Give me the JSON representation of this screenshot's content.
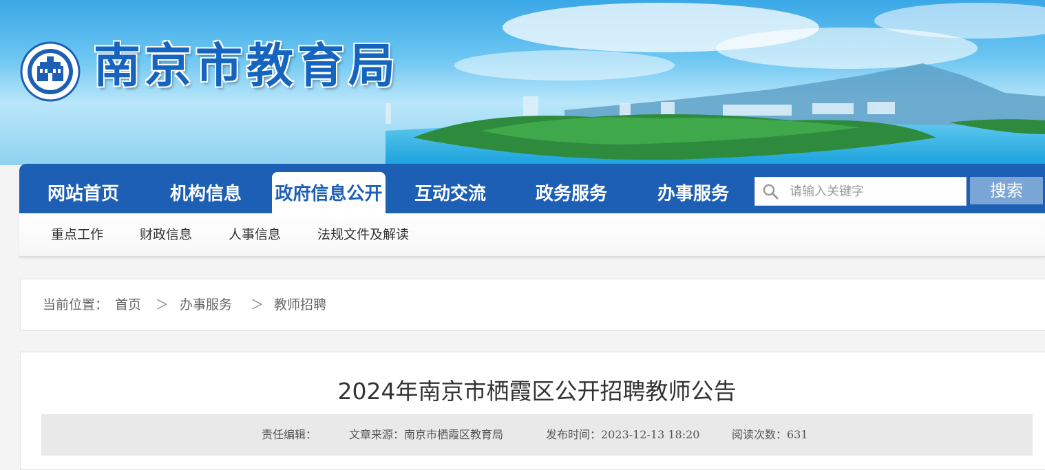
{
  "site": {
    "title": "南京市教育局"
  },
  "nav": {
    "items": [
      {
        "label": "网站首页"
      },
      {
        "label": "机构信息"
      },
      {
        "label": "政府信息公开"
      },
      {
        "label": "互动交流"
      },
      {
        "label": "政务服务"
      },
      {
        "label": "办事服务"
      }
    ],
    "active_item": "政府信息公开"
  },
  "search": {
    "placeholder": "请输入关键字",
    "button_label": "搜索"
  },
  "subnav": {
    "items": [
      {
        "label": "重点工作"
      },
      {
        "label": "财政信息"
      },
      {
        "label": "人事信息"
      },
      {
        "label": "法规文件及解读"
      }
    ]
  },
  "breadcrumb": {
    "prefix": "当前位置：",
    "items": [
      {
        "label": "首页"
      },
      {
        "label": "办事服务"
      },
      {
        "label": "教师招聘"
      }
    ],
    "separator": "＞"
  },
  "article": {
    "title": "2024年南京市栖霞区公开招聘教师公告",
    "editor_label": "责任编辑：",
    "source_label": "文章来源：南京市栖霞区教育局",
    "publish_label": "发布时间：2023-12-13 18:20",
    "views_label": "阅读次数：631"
  },
  "colors": {
    "nav_blue": "#1d5fb4",
    "search_button": "#7aa6d6",
    "meta_bar": "#e9e9e9"
  }
}
